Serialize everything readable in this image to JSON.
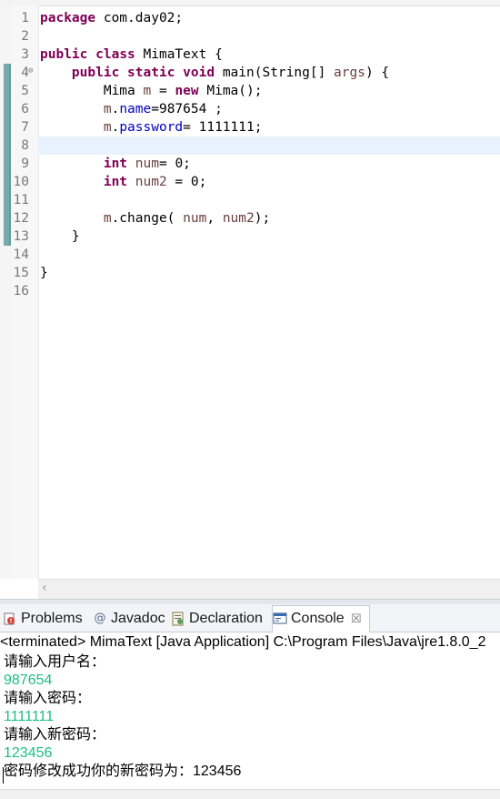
{
  "editor": {
    "lines": [
      {
        "n": "1",
        "parts": [
          {
            "t": "package",
            "c": "kw"
          },
          {
            "t": " com.day02;",
            "c": ""
          }
        ]
      },
      {
        "n": "2",
        "parts": []
      },
      {
        "n": "3",
        "parts": [
          {
            "t": "public",
            "c": "kw"
          },
          {
            "t": " ",
            "c": ""
          },
          {
            "t": "class",
            "c": "kw"
          },
          {
            "t": " MimaText {",
            "c": ""
          }
        ]
      },
      {
        "n": "4",
        "fold": true,
        "parts": [
          {
            "t": "    ",
            "c": ""
          },
          {
            "t": "public",
            "c": "kw"
          },
          {
            "t": " ",
            "c": ""
          },
          {
            "t": "static",
            "c": "kw"
          },
          {
            "t": " ",
            "c": ""
          },
          {
            "t": "void",
            "c": "kw"
          },
          {
            "t": " main(String[] ",
            "c": ""
          },
          {
            "t": "args",
            "c": "var"
          },
          {
            "t": ") {",
            "c": ""
          }
        ]
      },
      {
        "n": "5",
        "parts": [
          {
            "t": "        Mima ",
            "c": ""
          },
          {
            "t": "m",
            "c": "var"
          },
          {
            "t": " = ",
            "c": ""
          },
          {
            "t": "new",
            "c": "kw"
          },
          {
            "t": " Mima();",
            "c": ""
          }
        ]
      },
      {
        "n": "6",
        "parts": [
          {
            "t": "        ",
            "c": ""
          },
          {
            "t": "m",
            "c": "var"
          },
          {
            "t": ".",
            "c": ""
          },
          {
            "t": "name",
            "c": "fld"
          },
          {
            "t": "=987654 ;",
            "c": ""
          }
        ]
      },
      {
        "n": "7",
        "parts": [
          {
            "t": "        ",
            "c": ""
          },
          {
            "t": "m",
            "c": "var"
          },
          {
            "t": ".",
            "c": ""
          },
          {
            "t": "password",
            "c": "fld"
          },
          {
            "t": "= 1111111;",
            "c": ""
          }
        ]
      },
      {
        "n": "8",
        "parts": []
      },
      {
        "n": "9",
        "parts": [
          {
            "t": "        ",
            "c": ""
          },
          {
            "t": "int",
            "c": "kw"
          },
          {
            "t": " ",
            "c": ""
          },
          {
            "t": "num",
            "c": "var"
          },
          {
            "t": "= 0;",
            "c": ""
          }
        ]
      },
      {
        "n": "10",
        "parts": [
          {
            "t": "        ",
            "c": ""
          },
          {
            "t": "int",
            "c": "kw"
          },
          {
            "t": " ",
            "c": ""
          },
          {
            "t": "num2",
            "c": "var"
          },
          {
            "t": " = 0;",
            "c": ""
          }
        ]
      },
      {
        "n": "11",
        "parts": []
      },
      {
        "n": "12",
        "parts": [
          {
            "t": "        ",
            "c": ""
          },
          {
            "t": "m",
            "c": "var"
          },
          {
            "t": ".change( ",
            "c": ""
          },
          {
            "t": "num",
            "c": "var"
          },
          {
            "t": ", ",
            "c": ""
          },
          {
            "t": "num2",
            "c": "var"
          },
          {
            "t": ");",
            "c": ""
          }
        ]
      },
      {
        "n": "13",
        "parts": [
          {
            "t": "    }",
            "c": ""
          }
        ]
      },
      {
        "n": "14",
        "parts": []
      },
      {
        "n": "15",
        "parts": [
          {
            "t": "}",
            "c": ""
          }
        ]
      },
      {
        "n": "16",
        "parts": []
      }
    ]
  },
  "tabs": {
    "problems": "Problems",
    "javadoc": "Javadoc",
    "declaration": "Declaration",
    "console": "Console",
    "close": "☒"
  },
  "console": {
    "terminated": "<terminated> MimaText [Java Application] C:\\Program Files\\Java\\jre1.8.0_2",
    "lines": [
      {
        "text": "请输入用户名：",
        "kind": "prompt"
      },
      {
        "text": "987654",
        "kind": "input"
      },
      {
        "text": "请输入密码：",
        "kind": "prompt"
      },
      {
        "text": "1111111",
        "kind": "input"
      },
      {
        "text": "请输入新密码：",
        "kind": "prompt"
      },
      {
        "text": "123456",
        "kind": "input"
      },
      {
        "text": "密码修改成功你的新密码为：123456",
        "kind": "prompt"
      }
    ]
  },
  "colors": {
    "keyword": "#7f0055",
    "field": "#0000c0",
    "variable": "#6a3e3e",
    "console_input": "#1fbd83",
    "current_line": "#e8f2fe"
  }
}
